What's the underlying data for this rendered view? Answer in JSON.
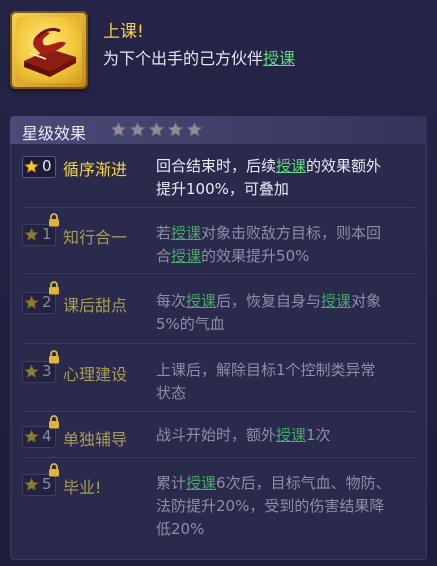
{
  "skill": {
    "title": "上课!",
    "desc_prefix": "为下个出手的己方伙伴",
    "desc_keyword": "授课"
  },
  "section": {
    "title": "星级效果",
    "star_count": 5
  },
  "colors": {
    "gold": "#f3d24a",
    "keyword_green": "#5fd882",
    "text": "#ecebf5",
    "locked_text": "#8e8ea6"
  },
  "effects": [
    {
      "level": "0",
      "name": "循序渐进",
      "locked": false,
      "line1_a": "回合结束时，后续",
      "line1_kw": "授课",
      "line1_b": "的效果额外",
      "line2": "提升100%，可叠加"
    },
    {
      "level": "1",
      "name": "知行合一",
      "locked": true,
      "line1_a": "若",
      "line1_kw": "授课",
      "line1_b": "对象击败敌方目标，则本回",
      "line2_a": "合",
      "line2_kw": "授课",
      "line2_b": "的效果提升50%"
    },
    {
      "level": "2",
      "name": "课后甜点",
      "locked": true,
      "line1_a": "每次",
      "line1_kw": "授课",
      "line1_b": "后，恢复自身与",
      "line1_kw2": "授课",
      "line1_c": "对象",
      "line2": "5%的气血"
    },
    {
      "level": "3",
      "name": "心理建设",
      "locked": true,
      "line1": "上课后，解除目标1个控制类异常",
      "line2": "状态"
    },
    {
      "level": "4",
      "name": "单独辅导",
      "locked": true,
      "line1_a": "战斗开始时，额外",
      "line1_kw": "授课",
      "line1_b": "1次"
    },
    {
      "level": "5",
      "name": "毕业!",
      "locked": true,
      "line1_a": "累计",
      "line1_kw": "授课",
      "line1_b": "6次后，目标气血、物防、",
      "line2": "法防提升20%，受到的伤害结果降",
      "line3": "低20%"
    }
  ]
}
